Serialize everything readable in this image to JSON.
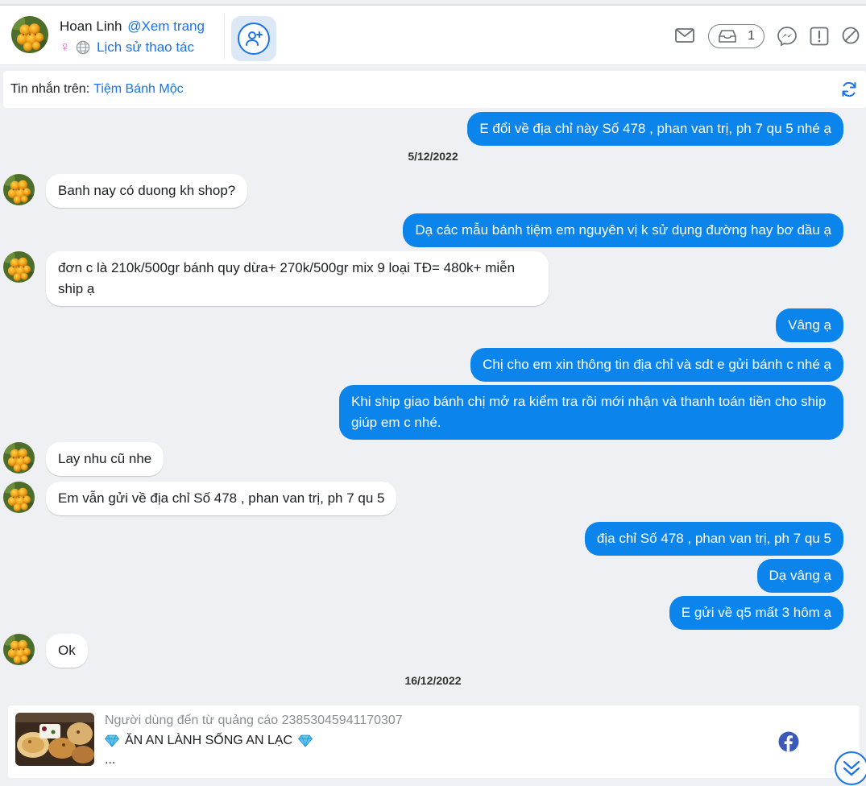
{
  "header": {
    "name": "Hoan Linh",
    "view_page": "@Xem trang",
    "gender_symbol": "♀",
    "history": "Lịch sử thao tác",
    "inbox_count": "1"
  },
  "source": {
    "label": "Tin nhắn trên:",
    "page": "Tiệm Bánh Mộc"
  },
  "conversation": {
    "pinned_out": "E đổi về địa chỉ này Số 478 , phan van trị, ph 7 qu 5 nhé ạ",
    "date_1": "5/12/2022",
    "m1": "Banh nay có duong kh shop?",
    "m2": "Dạ các mẫu bánh tiệm em nguyên vị k sử dụng đường hay bơ dầu ạ",
    "m3": "đơn c là 210k/500gr bánh quy dừa+ 270k/500gr mix 9 loại TĐ= 480k+ miễn ship ạ",
    "m4": "Vâng ạ",
    "m5": "Chị cho em xin thông tin địa chỉ và sdt e gửi bánh c nhé ạ",
    "m6": "Khi ship giao bánh chị mở ra kiểm tra rồi mới nhận và thanh toán tiền cho ship giúp em c nhé.",
    "m7": "Lay nhu cũ nhe",
    "m8": "Em vẫn gửi về địa chỉ Số 478 , phan van trị, ph 7 qu 5",
    "m9": "địa chỉ Số 478 , phan van trị, ph 7 qu 5",
    "m10": "Dạ vâng ạ",
    "m11": "E gửi về q5 mất 3 hôm ạ",
    "m12": "Ok",
    "date_2": "16/12/2022"
  },
  "ad": {
    "source": "Người dùng đến từ quảng cáo 23853045941170307",
    "title": "ĂN AN LÀNH SỐNG AN LẠC",
    "more": "..."
  },
  "colors": {
    "accent": "#1a73e8",
    "outgoing_bubble": "#0b84ec",
    "background": "#eef0f3"
  },
  "icons": [
    "mail-icon",
    "inbox-icon",
    "messenger-icon",
    "report-icon",
    "block-icon",
    "refresh-icon",
    "add-friend-icon",
    "globe-icon",
    "diamond-icon",
    "facebook-icon",
    "double-chevron-down-icon"
  ]
}
